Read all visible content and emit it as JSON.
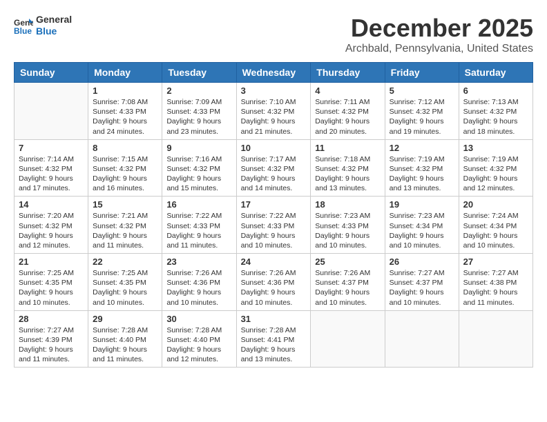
{
  "logo": {
    "line1": "General",
    "line2": "Blue"
  },
  "title": "December 2025",
  "location": "Archbald, Pennsylvania, United States",
  "days_of_week": [
    "Sunday",
    "Monday",
    "Tuesday",
    "Wednesday",
    "Thursday",
    "Friday",
    "Saturday"
  ],
  "weeks": [
    [
      {
        "day": "",
        "sunrise": "",
        "sunset": "",
        "daylight": ""
      },
      {
        "day": "1",
        "sunrise": "Sunrise: 7:08 AM",
        "sunset": "Sunset: 4:33 PM",
        "daylight": "Daylight: 9 hours and 24 minutes."
      },
      {
        "day": "2",
        "sunrise": "Sunrise: 7:09 AM",
        "sunset": "Sunset: 4:33 PM",
        "daylight": "Daylight: 9 hours and 23 minutes."
      },
      {
        "day": "3",
        "sunrise": "Sunrise: 7:10 AM",
        "sunset": "Sunset: 4:32 PM",
        "daylight": "Daylight: 9 hours and 21 minutes."
      },
      {
        "day": "4",
        "sunrise": "Sunrise: 7:11 AM",
        "sunset": "Sunset: 4:32 PM",
        "daylight": "Daylight: 9 hours and 20 minutes."
      },
      {
        "day": "5",
        "sunrise": "Sunrise: 7:12 AM",
        "sunset": "Sunset: 4:32 PM",
        "daylight": "Daylight: 9 hours and 19 minutes."
      },
      {
        "day": "6",
        "sunrise": "Sunrise: 7:13 AM",
        "sunset": "Sunset: 4:32 PM",
        "daylight": "Daylight: 9 hours and 18 minutes."
      }
    ],
    [
      {
        "day": "7",
        "sunrise": "Sunrise: 7:14 AM",
        "sunset": "Sunset: 4:32 PM",
        "daylight": "Daylight: 9 hours and 17 minutes."
      },
      {
        "day": "8",
        "sunrise": "Sunrise: 7:15 AM",
        "sunset": "Sunset: 4:32 PM",
        "daylight": "Daylight: 9 hours and 16 minutes."
      },
      {
        "day": "9",
        "sunrise": "Sunrise: 7:16 AM",
        "sunset": "Sunset: 4:32 PM",
        "daylight": "Daylight: 9 hours and 15 minutes."
      },
      {
        "day": "10",
        "sunrise": "Sunrise: 7:17 AM",
        "sunset": "Sunset: 4:32 PM",
        "daylight": "Daylight: 9 hours and 14 minutes."
      },
      {
        "day": "11",
        "sunrise": "Sunrise: 7:18 AM",
        "sunset": "Sunset: 4:32 PM",
        "daylight": "Daylight: 9 hours and 13 minutes."
      },
      {
        "day": "12",
        "sunrise": "Sunrise: 7:19 AM",
        "sunset": "Sunset: 4:32 PM",
        "daylight": "Daylight: 9 hours and 13 minutes."
      },
      {
        "day": "13",
        "sunrise": "Sunrise: 7:19 AM",
        "sunset": "Sunset: 4:32 PM",
        "daylight": "Daylight: 9 hours and 12 minutes."
      }
    ],
    [
      {
        "day": "14",
        "sunrise": "Sunrise: 7:20 AM",
        "sunset": "Sunset: 4:32 PM",
        "daylight": "Daylight: 9 hours and 12 minutes."
      },
      {
        "day": "15",
        "sunrise": "Sunrise: 7:21 AM",
        "sunset": "Sunset: 4:32 PM",
        "daylight": "Daylight: 9 hours and 11 minutes."
      },
      {
        "day": "16",
        "sunrise": "Sunrise: 7:22 AM",
        "sunset": "Sunset: 4:33 PM",
        "daylight": "Daylight: 9 hours and 11 minutes."
      },
      {
        "day": "17",
        "sunrise": "Sunrise: 7:22 AM",
        "sunset": "Sunset: 4:33 PM",
        "daylight": "Daylight: 9 hours and 10 minutes."
      },
      {
        "day": "18",
        "sunrise": "Sunrise: 7:23 AM",
        "sunset": "Sunset: 4:33 PM",
        "daylight": "Daylight: 9 hours and 10 minutes."
      },
      {
        "day": "19",
        "sunrise": "Sunrise: 7:23 AM",
        "sunset": "Sunset: 4:34 PM",
        "daylight": "Daylight: 9 hours and 10 minutes."
      },
      {
        "day": "20",
        "sunrise": "Sunrise: 7:24 AM",
        "sunset": "Sunset: 4:34 PM",
        "daylight": "Daylight: 9 hours and 10 minutes."
      }
    ],
    [
      {
        "day": "21",
        "sunrise": "Sunrise: 7:25 AM",
        "sunset": "Sunset: 4:35 PM",
        "daylight": "Daylight: 9 hours and 10 minutes."
      },
      {
        "day": "22",
        "sunrise": "Sunrise: 7:25 AM",
        "sunset": "Sunset: 4:35 PM",
        "daylight": "Daylight: 9 hours and 10 minutes."
      },
      {
        "day": "23",
        "sunrise": "Sunrise: 7:26 AM",
        "sunset": "Sunset: 4:36 PM",
        "daylight": "Daylight: 9 hours and 10 minutes."
      },
      {
        "day": "24",
        "sunrise": "Sunrise: 7:26 AM",
        "sunset": "Sunset: 4:36 PM",
        "daylight": "Daylight: 9 hours and 10 minutes."
      },
      {
        "day": "25",
        "sunrise": "Sunrise: 7:26 AM",
        "sunset": "Sunset: 4:37 PM",
        "daylight": "Daylight: 9 hours and 10 minutes."
      },
      {
        "day": "26",
        "sunrise": "Sunrise: 7:27 AM",
        "sunset": "Sunset: 4:37 PM",
        "daylight": "Daylight: 9 hours and 10 minutes."
      },
      {
        "day": "27",
        "sunrise": "Sunrise: 7:27 AM",
        "sunset": "Sunset: 4:38 PM",
        "daylight": "Daylight: 9 hours and 11 minutes."
      }
    ],
    [
      {
        "day": "28",
        "sunrise": "Sunrise: 7:27 AM",
        "sunset": "Sunset: 4:39 PM",
        "daylight": "Daylight: 9 hours and 11 minutes."
      },
      {
        "day": "29",
        "sunrise": "Sunrise: 7:28 AM",
        "sunset": "Sunset: 4:40 PM",
        "daylight": "Daylight: 9 hours and 11 minutes."
      },
      {
        "day": "30",
        "sunrise": "Sunrise: 7:28 AM",
        "sunset": "Sunset: 4:40 PM",
        "daylight": "Daylight: 9 hours and 12 minutes."
      },
      {
        "day": "31",
        "sunrise": "Sunrise: 7:28 AM",
        "sunset": "Sunset: 4:41 PM",
        "daylight": "Daylight: 9 hours and 13 minutes."
      },
      {
        "day": "",
        "sunrise": "",
        "sunset": "",
        "daylight": ""
      },
      {
        "day": "",
        "sunrise": "",
        "sunset": "",
        "daylight": ""
      },
      {
        "day": "",
        "sunrise": "",
        "sunset": "",
        "daylight": ""
      }
    ]
  ]
}
